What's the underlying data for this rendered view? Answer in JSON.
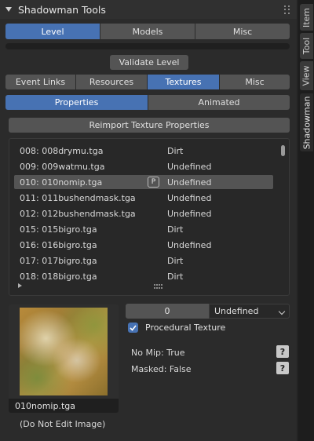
{
  "panel": {
    "title": "Shadowman Tools"
  },
  "main_tabs": [
    {
      "label": "Level",
      "active": true
    },
    {
      "label": "Models",
      "active": false
    },
    {
      "label": "Misc",
      "active": false
    }
  ],
  "validate_button": "Validate Level",
  "sub_tabs": [
    {
      "label": "Event Links",
      "active": false
    },
    {
      "label": "Resources",
      "active": false
    },
    {
      "label": "Textures",
      "active": true
    },
    {
      "label": "Misc",
      "active": false
    }
  ],
  "texture_tabs": [
    {
      "label": "Properties",
      "active": true
    },
    {
      "label": "Animated",
      "active": false
    }
  ],
  "reimport_button": "Reimport Texture Properties",
  "texture_list": [
    {
      "name": "008: 008drymu.tga",
      "category": "Dirt",
      "selected": false
    },
    {
      "name": "009: 009watmu.tga",
      "category": "Undefined",
      "selected": false
    },
    {
      "name": "010: 010nomip.tga",
      "category": "Undefined",
      "selected": true,
      "badge": "P"
    },
    {
      "name": "011: 011bushendmask.tga",
      "category": "Undefined",
      "selected": false
    },
    {
      "name": "012: 012bushendmask.tga",
      "category": "Undefined",
      "selected": false
    },
    {
      "name": "015: 015bigro.tga",
      "category": "Dirt",
      "selected": false
    },
    {
      "name": "016: 016bigro.tga",
      "category": "Undefined",
      "selected": false
    },
    {
      "name": "017: 017bigro.tga",
      "category": "Dirt",
      "selected": false
    },
    {
      "name": "018: 018bigro.tga",
      "category": "Dirt",
      "selected": false
    }
  ],
  "preview": {
    "filename": "010nomip.tga",
    "note": "(Do Not Edit Image)"
  },
  "properties": {
    "index_value": "0",
    "category_value": "Undefined",
    "procedural_label": "Procedural Texture",
    "procedural_checked": true,
    "no_mip": "No Mip: True",
    "masked": "Masked: False",
    "help_glyph": "?"
  },
  "sidebar_tabs": [
    {
      "label": "Item",
      "active": false
    },
    {
      "label": "Tool",
      "active": false
    },
    {
      "label": "View",
      "active": false
    },
    {
      "label": "Shadowman",
      "active": true
    }
  ],
  "colors": {
    "accent": "#4772b3",
    "panel_bg": "#2b2b2b",
    "button_bg": "#545454"
  }
}
